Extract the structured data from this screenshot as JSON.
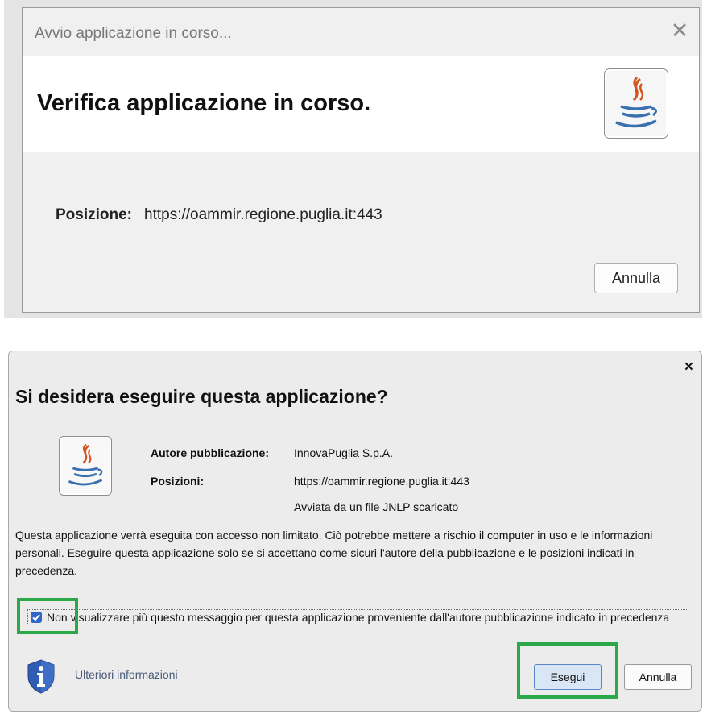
{
  "dialog1": {
    "title": "Avvio applicazione in corso...",
    "close_glyph": "✕",
    "heading": "Verifica applicazione in corso.",
    "position_label": "Posizione:",
    "position_value": "https://oammir.regione.puglia.it:443",
    "cancel_label": "Annulla"
  },
  "dialog2": {
    "close_glyph": "×",
    "title": "Si desidera eseguire questa applicazione?",
    "publisher_label": "Autore pubblicazione:",
    "publisher_value": "InnovaPuglia S.p.A.",
    "locations_label": "Posizioni:",
    "location_value": "https://oammir.regione.puglia.it:443",
    "launched_from": "Avviata da un file JNLP scaricato",
    "description": "Questa applicazione verrà eseguita con accesso non limitato. Ciò potrebbe mettere a rischio il computer in uso e le informazioni personali. Eseguire questa applicazione solo se si accettano come sicuri l'autore della pubblicazione e le posizioni indicati in precedenza.",
    "checkbox_checked": true,
    "checkbox_label": "Non visualizzare più questo messaggio per questa applicazione proveniente dall'autore pubblicazione indicato in precedenza",
    "more_info_label": "Ulteriori informazioni",
    "run_label": "Esegui",
    "cancel_label": "Annulla"
  },
  "icons": {
    "java": "java-coffee-cup-icon",
    "info_shield": "info-shield-icon"
  },
  "colors": {
    "highlight": "#2aa84a",
    "checkbox": "#2e66c9",
    "shield": "#2e5db3"
  }
}
